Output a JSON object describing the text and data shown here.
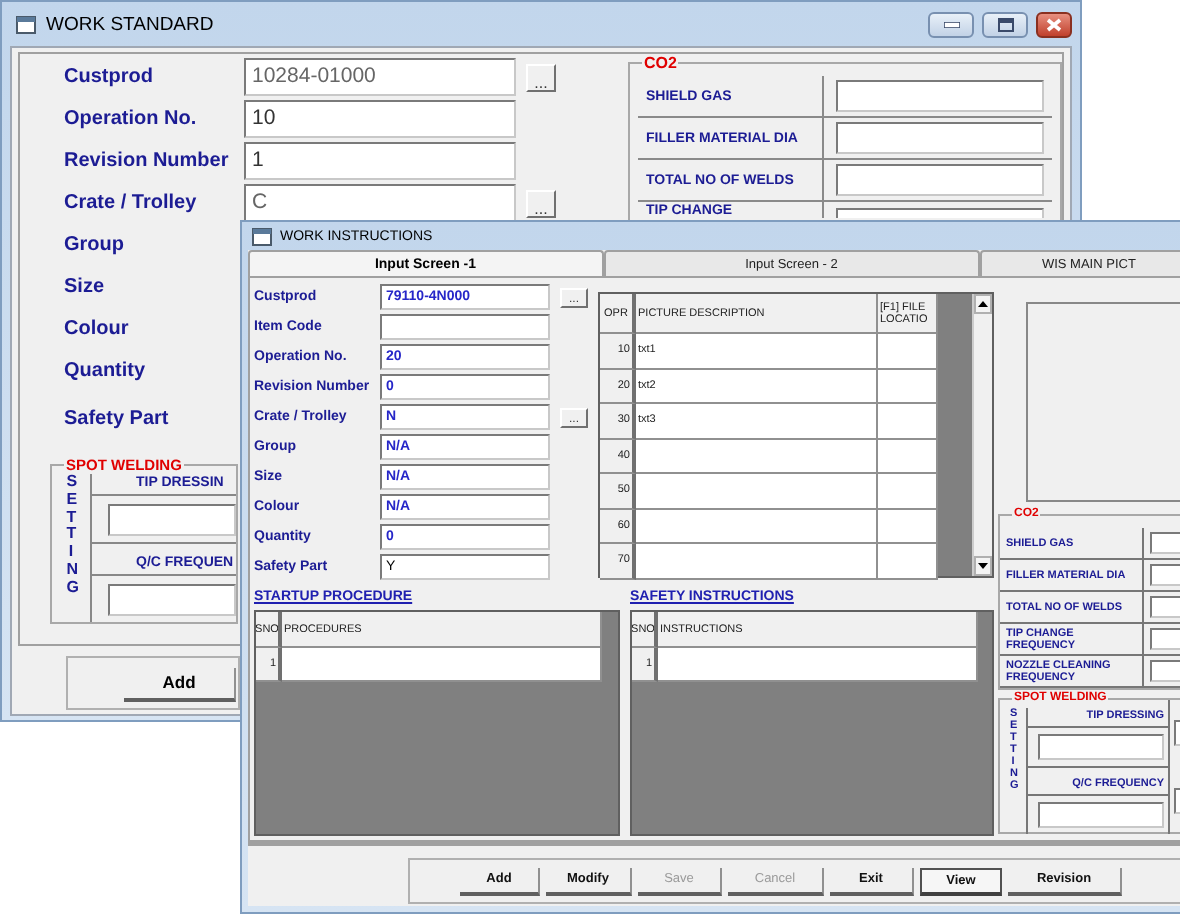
{
  "work_standard": {
    "title": "WORK STANDARD",
    "fields": [
      {
        "kind": "field",
        "label": "Custprod",
        "value": "10284-01000",
        "disabled": true,
        "button": "..."
      },
      {
        "kind": "field",
        "label": "Operation No.",
        "value": "10",
        "disabled": false
      },
      {
        "kind": "field",
        "label": "Revision Number",
        "value": "1",
        "disabled": false
      },
      {
        "kind": "field",
        "label": "Crate / Trolley",
        "value": "C",
        "disabled": true,
        "button": "..."
      },
      {
        "kind": "label",
        "label": "Group"
      },
      {
        "kind": "label",
        "label": "Size"
      },
      {
        "kind": "label",
        "label": "Colour"
      },
      {
        "kind": "label",
        "label": "Quantity"
      },
      {
        "kind": "label",
        "label": "Safety Part"
      }
    ],
    "co2": {
      "title": "CO2",
      "rows": [
        "SHIELD GAS",
        "FILLER MATERIAL DIA",
        "TOTAL NO OF WELDS",
        "TIP CHANGE"
      ]
    },
    "spot_welding": {
      "title": "SPOT WELDING",
      "side_label": "SETTING",
      "rows": [
        "TIP DRESSIN",
        "Q/C FREQUEN"
      ]
    },
    "buttons": [
      "Add"
    ]
  },
  "work_instructions": {
    "title": "WORK INSTRUCTIONS",
    "tabs": [
      {
        "label": "Input Screen -1",
        "selected": true
      },
      {
        "label": "Input Screen - 2",
        "selected": false
      },
      {
        "label": "WIS MAIN PICT",
        "selected": false
      }
    ],
    "fields": [
      {
        "kind": "lookup",
        "label": "Custprod",
        "value": "79110-4N000",
        "button": "..."
      },
      {
        "kind": "lookup",
        "label": "Item Code"
      },
      {
        "kind": "lookup",
        "label": "Operation No.",
        "value": "20"
      },
      {
        "kind": "lookup",
        "label": "Revision Number",
        "value": "0"
      },
      {
        "kind": "lookup",
        "label": "Crate / Trolley",
        "value": "N",
        "button": "..."
      },
      {
        "kind": "lookup",
        "label": "Group",
        "value": "N/A"
      },
      {
        "kind": "lookup",
        "label": "Size",
        "value": "N/A"
      },
      {
        "kind": "lookup",
        "label": "Colour",
        "value": "N/A"
      },
      {
        "kind": "lookup",
        "label": "Quantity",
        "value": "0"
      },
      {
        "kind": "input",
        "label": "Safety Part",
        "value": "Y"
      }
    ],
    "picture_grid": {
      "columns": [
        "OPR",
        "PICTURE DESCRIPTION",
        "[F1] FILE LOCATIO"
      ],
      "rows": [
        {
          "opr": "10",
          "description": "txt1"
        },
        {
          "opr": "20",
          "description": "txt2"
        },
        {
          "opr": "30",
          "description": "txt3"
        },
        {
          "opr": "40"
        },
        {
          "opr": "50"
        },
        {
          "opr": "60"
        },
        {
          "opr": "70"
        }
      ]
    },
    "startup_procedure": {
      "title": "STARTUP PROCEDURE",
      "columns": [
        "SNO",
        "PROCEDURES"
      ],
      "rows": [
        "1"
      ]
    },
    "safety_instructions": {
      "title": "SAFETY INSTRUCTIONS",
      "columns": [
        "SNO",
        "INSTRUCTIONS"
      ],
      "rows": [
        "1"
      ]
    },
    "co2": {
      "title": "CO2",
      "rows": [
        "SHIELD GAS",
        "FILLER MATERIAL DIA",
        "TOTAL NO OF WELDS",
        "TIP CHANGE FREQUENCY",
        "NOZZLE CLEANING FREQUENCY"
      ]
    },
    "spot_welding": {
      "title": "SPOT WELDING",
      "side_label": "SETTING",
      "rows": [
        "TIP DRESSING",
        "Q/C FREQUENCY"
      ]
    },
    "buttons": [
      {
        "label": "Add",
        "disabled": false,
        "focused": false
      },
      {
        "label": "Modify",
        "disabled": false,
        "focused": false
      },
      {
        "label": "Save",
        "disabled": true,
        "focused": false
      },
      {
        "label": "Cancel",
        "disabled": true,
        "focused": false
      },
      {
        "label": "Exit",
        "disabled": false,
        "focused": false
      },
      {
        "label": "View",
        "disabled": false,
        "focused": true
      },
      {
        "label": "Revision",
        "disabled": false,
        "focused": false
      }
    ]
  }
}
